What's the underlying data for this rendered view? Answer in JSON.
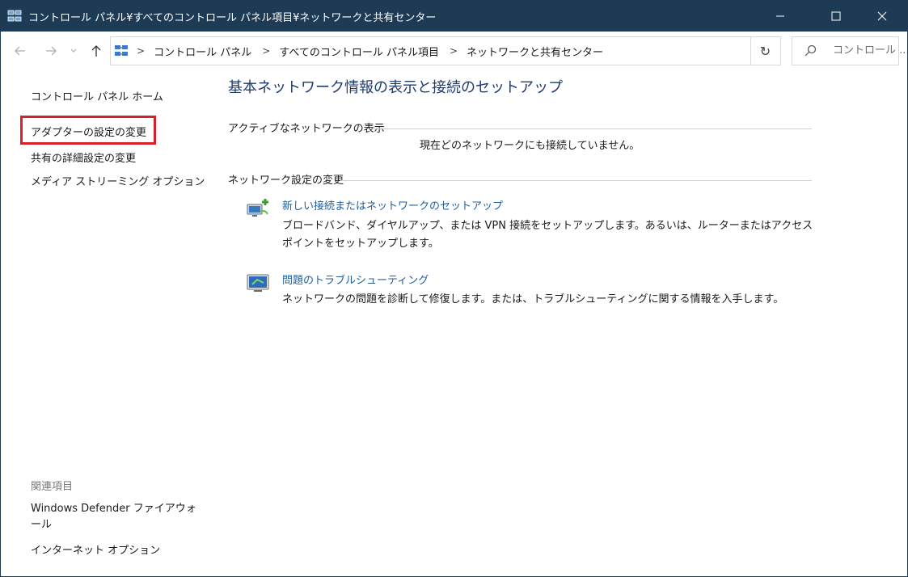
{
  "window": {
    "title": "コントロール パネル¥すべてのコントロール パネル項目¥ネットワークと共有センター",
    "minimize": "—",
    "maximize": "☐",
    "close": "✕"
  },
  "navigation": {
    "back_icon": "back-arrow-icon",
    "forward_icon": "forward-arrow-icon",
    "history_icon": "chevron-down-icon",
    "up_icon": "up-arrow-icon",
    "breadcrumbs": [
      "コントロール パネル",
      "すべてのコントロール パネル項目",
      "ネットワークと共有センター"
    ],
    "separator": ">",
    "dropdown": "⌄",
    "refresh": "↻",
    "search_placeholder": "コントロール ..."
  },
  "sidebar": {
    "home": "コントロール パネル ホーム",
    "items": [
      "アダプターの設定の変更",
      "共有の詳細設定の変更",
      "メディア ストリーミング オプション"
    ],
    "related_header": "関連項目",
    "related_items": [
      "Windows Defender ファイアウォール",
      "インターネット オプション"
    ],
    "highlight_color": "#d8202a"
  },
  "main": {
    "title": "基本ネットワーク情報の表示と接続のセットアップ",
    "active_network_label": "アクティブなネットワークの表示",
    "no_network_text": "現在どのネットワークにも接続していません。",
    "settings_label": "ネットワーク設定の変更",
    "tasks": [
      {
        "icon": "network-setup-icon",
        "link": "新しい接続またはネットワークのセットアップ",
        "description": "ブロードバンド、ダイヤルアップ、または VPN 接続をセットアップします。あるいは、ルーターまたはアクセス ポイントをセットアップします。"
      },
      {
        "icon": "troubleshoot-icon",
        "link": "問題のトラブルシューティング",
        "description": "ネットワークの問題を診断して修復します。または、トラブルシューティングに関する情報を入手します。"
      }
    ]
  },
  "colors": {
    "titlebar": "#1e3b56",
    "link": "#1e5f9e",
    "heading": "#1e3b6e"
  }
}
